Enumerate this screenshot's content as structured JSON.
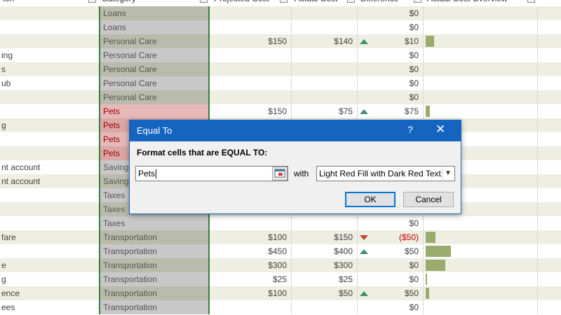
{
  "header": {
    "columns": [
      "ion",
      "Category",
      "Projected Cost",
      "Actual Cost",
      "Difference",
      "Actual Cost Overview"
    ]
  },
  "rows": [
    {
      "desc": "",
      "cat": "Loans",
      "proj": "",
      "act": "",
      "ind": "",
      "diff": "$0",
      "bar": 0
    },
    {
      "desc": "",
      "cat": "Loans",
      "proj": "",
      "act": "",
      "ind": "",
      "diff": "$0",
      "bar": 0
    },
    {
      "desc": "",
      "cat": "Personal Care",
      "proj": "$150",
      "act": "$140",
      "ind": "up",
      "diff": "$10",
      "bar": 12
    },
    {
      "desc": "ing",
      "cat": "Personal Care",
      "proj": "",
      "act": "",
      "ind": "",
      "diff": "$0",
      "bar": 0
    },
    {
      "desc": "s",
      "cat": "Personal Care",
      "proj": "",
      "act": "",
      "ind": "",
      "diff": "$0",
      "bar": 0
    },
    {
      "desc": "ub",
      "cat": "Personal Care",
      "proj": "",
      "act": "",
      "ind": "",
      "diff": "$0",
      "bar": 0
    },
    {
      "desc": "",
      "cat": "Personal Care",
      "proj": "",
      "act": "",
      "ind": "",
      "diff": "$0",
      "bar": 0
    },
    {
      "desc": "",
      "cat": "Pets",
      "proj": "$150",
      "act": "$75",
      "ind": "up",
      "diff": "$75",
      "bar": 6
    },
    {
      "desc": "g",
      "cat": "Pets",
      "proj": "",
      "act": "",
      "ind": "",
      "diff": "",
      "bar": 0
    },
    {
      "desc": "",
      "cat": "Pets",
      "proj": "",
      "act": "",
      "ind": "",
      "diff": "",
      "bar": 0
    },
    {
      "desc": "",
      "cat": "Pets",
      "proj": "",
      "act": "",
      "ind": "",
      "diff": "",
      "bar": 0
    },
    {
      "desc": "nt account",
      "cat": "Savings",
      "proj": "",
      "act": "",
      "ind": "",
      "diff": "",
      "bar": 0
    },
    {
      "desc": "nt account",
      "cat": "Savings",
      "proj": "",
      "act": "",
      "ind": "",
      "diff": "",
      "bar": 0
    },
    {
      "desc": "",
      "cat": "Taxes",
      "proj": "",
      "act": "",
      "ind": "",
      "diff": "",
      "bar": 0
    },
    {
      "desc": "",
      "cat": "Taxes",
      "proj": "",
      "act": "",
      "ind": "",
      "diff": "",
      "bar": 0
    },
    {
      "desc": "",
      "cat": "Taxes",
      "proj": "",
      "act": "",
      "ind": "",
      "diff": "$0",
      "bar": 0
    },
    {
      "desc": "fare",
      "cat": "Transportation",
      "proj": "$100",
      "act": "$150",
      "ind": "down",
      "diff": "($50)",
      "bar": 14
    },
    {
      "desc": "",
      "cat": "Transportation",
      "proj": "$450",
      "act": "$400",
      "ind": "up",
      "diff": "$50",
      "bar": 36
    },
    {
      "desc": "e",
      "cat": "Transportation",
      "proj": "$300",
      "act": "$300",
      "ind": "",
      "diff": "$0",
      "bar": 28
    },
    {
      "desc": "g",
      "cat": "Transportation",
      "proj": "$25",
      "act": "$25",
      "ind": "",
      "diff": "$0",
      "bar": 2
    },
    {
      "desc": "ence",
      "cat": "Transportation",
      "proj": "$100",
      "act": "$50",
      "ind": "up",
      "diff": "$50",
      "bar": 5
    },
    {
      "desc": "ees",
      "cat": "Transportation",
      "proj": "",
      "act": "",
      "ind": "",
      "diff": "$0",
      "bar": 0
    }
  ],
  "dialog": {
    "title": "Equal To",
    "help": "?",
    "close": "✕",
    "instruction": "Format cells that are EQUAL TO:",
    "value": "Pets",
    "with_label": "with",
    "format_option": "Light Red Fill with Dark Red Text",
    "ok_label": "OK",
    "cancel_label": "Cancel"
  }
}
